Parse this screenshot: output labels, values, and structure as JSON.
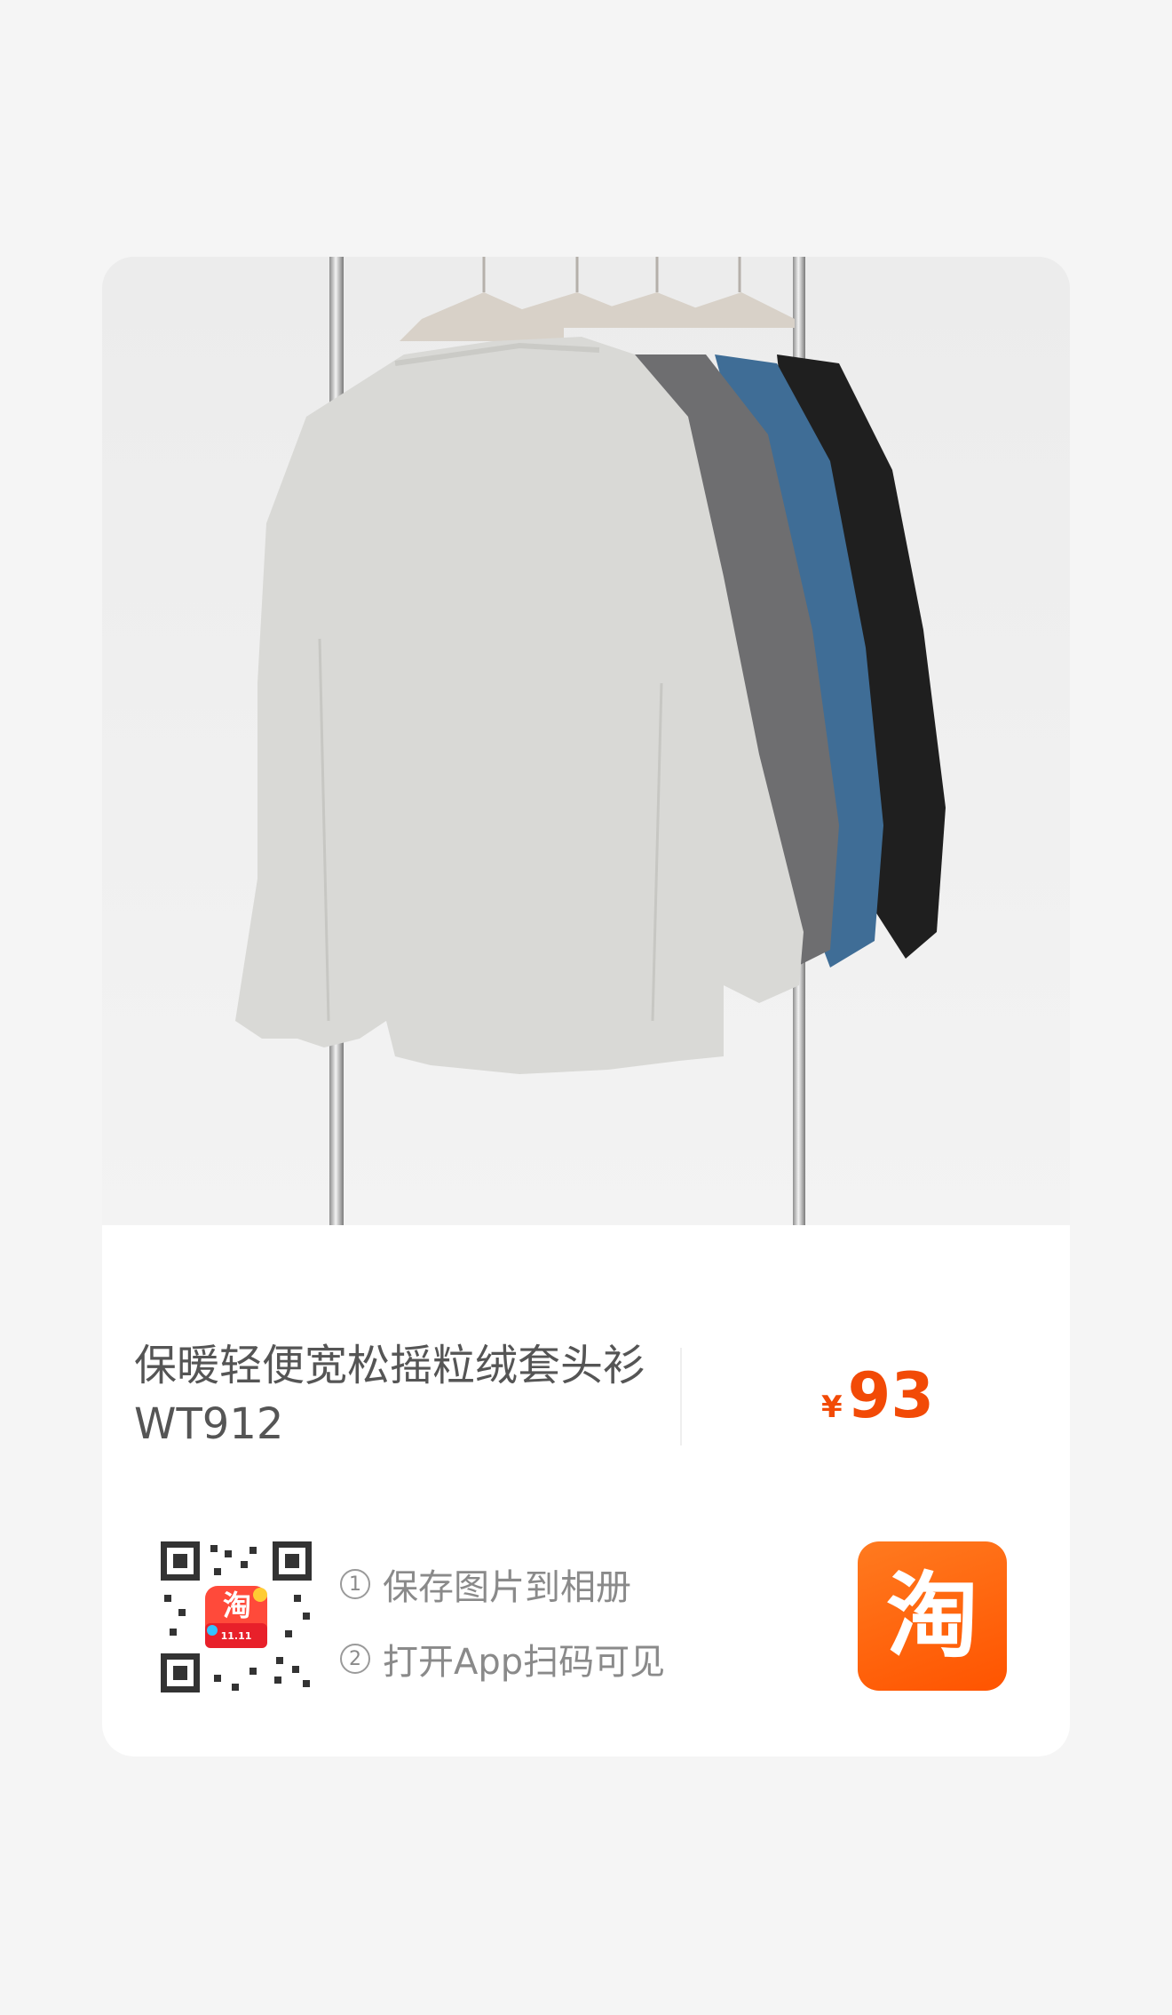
{
  "product": {
    "title_line1": "保暖轻便宽松摇粒绒套头衫",
    "title_line2": "WT912",
    "price_currency": "¥",
    "price_amount": "93"
  },
  "share": {
    "steps": [
      {
        "num": "1",
        "text": "保存图片到相册"
      },
      {
        "num": "2",
        "text": "打开App扫码可见"
      }
    ],
    "qr_badge_text": "淘",
    "qr_badge_subtext": "11.11"
  },
  "logo": {
    "text": "淘"
  },
  "colors": {
    "accent": "#f24a06",
    "logo_orange": "#ff5a00",
    "text_gray": "#555555",
    "hint_gray": "#8a8a8a"
  },
  "image": {
    "description_icon": "product-photo-sweatshirts-on-rack",
    "garment_colors": [
      "#d9d9d6",
      "#6e6e70",
      "#3f6d96",
      "#1d1d1d"
    ]
  }
}
